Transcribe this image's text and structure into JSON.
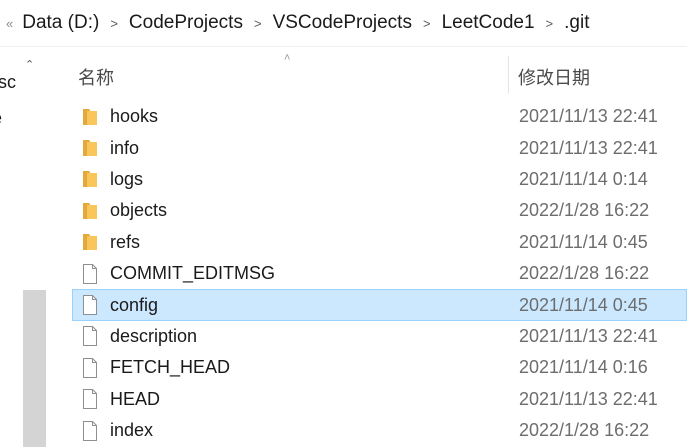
{
  "breadcrumb": {
    "overflow": "«",
    "items": [
      "Data (D:)",
      "CodeProjects",
      "VSCodeProjects",
      "LeetCode1",
      ".git"
    ],
    "separator": ">"
  },
  "nav_pane": {
    "partial_items": [
      "rsc",
      "e"
    ]
  },
  "columns": {
    "name": "名称",
    "date_modified": "修改日期"
  },
  "rows": [
    {
      "name": "hooks",
      "date": "2021/11/13 22:41",
      "type": "folder"
    },
    {
      "name": "info",
      "date": "2021/11/13 22:41",
      "type": "folder"
    },
    {
      "name": "logs",
      "date": "2021/11/14 0:14",
      "type": "folder"
    },
    {
      "name": "objects",
      "date": "2022/1/28 16:22",
      "type": "folder"
    },
    {
      "name": "refs",
      "date": "2021/11/14 0:45",
      "type": "folder"
    },
    {
      "name": "COMMIT_EDITMSG",
      "date": "2022/1/28 16:22",
      "type": "file"
    },
    {
      "name": "config",
      "date": "2021/11/14 0:45",
      "type": "file",
      "selected": true
    },
    {
      "name": "description",
      "date": "2021/11/13 22:41",
      "type": "file"
    },
    {
      "name": "FETCH_HEAD",
      "date": "2021/11/14 0:16",
      "type": "file"
    },
    {
      "name": "HEAD",
      "date": "2021/11/13 22:41",
      "type": "file"
    },
    {
      "name": "index",
      "date": "2022/1/28 16:22",
      "type": "file"
    }
  ],
  "colors": {
    "selection_bg": "#cce8ff",
    "selection_border": "#99d1ff",
    "folder": "#f8c65a"
  }
}
